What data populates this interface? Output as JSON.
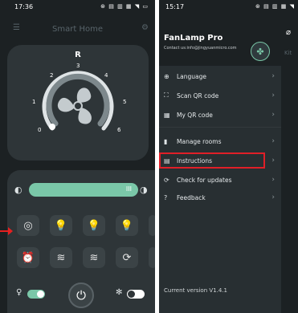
{
  "left_screen": {
    "status": {
      "time": "17:36",
      "icons": "⊛ ▤ ▥ ▦ ◥ ▭"
    },
    "header": {
      "title": "Smart Home"
    },
    "fan": {
      "direction_label": "R",
      "speed_ticks": [
        "0",
        "1",
        "2",
        "3",
        "4",
        "5",
        "6"
      ],
      "speed_level": 0
    },
    "brightness": {
      "value_fraction": 0.95,
      "handle_label": "III"
    },
    "buttons_row1": [
      "(◎)",
      "bulb",
      "bulb",
      "bulb"
    ],
    "buttons_row2": [
      "alarm",
      "wind",
      "wind",
      "reverse"
    ],
    "colors": {
      "accent": "#7ac7a8",
      "bulb": "#f2c230"
    }
  },
  "right_screen": {
    "status": {
      "time": "15:17",
      "icons": "⊛ ▤ ▥ ▦ ◥"
    },
    "drawer": {
      "app_name": "FanLamp Pro",
      "contact": "Contact us:info@jingyuanmicro.com",
      "items": [
        {
          "label": "Language",
          "icon": "globe-icon"
        },
        {
          "label": "Scan QR code",
          "icon": "scan-icon"
        },
        {
          "label": "My QR code",
          "icon": "qr-icon"
        },
        {
          "label": "Manage rooms",
          "icon": "room-icon"
        },
        {
          "label": "Instructions",
          "icon": "document-icon"
        },
        {
          "label": "Check for updates",
          "icon": "refresh-icon"
        },
        {
          "label": "Feedback",
          "icon": "help-icon"
        }
      ],
      "version": "Current version V1.4.1"
    },
    "main_peek": {
      "text": "Kit"
    }
  }
}
